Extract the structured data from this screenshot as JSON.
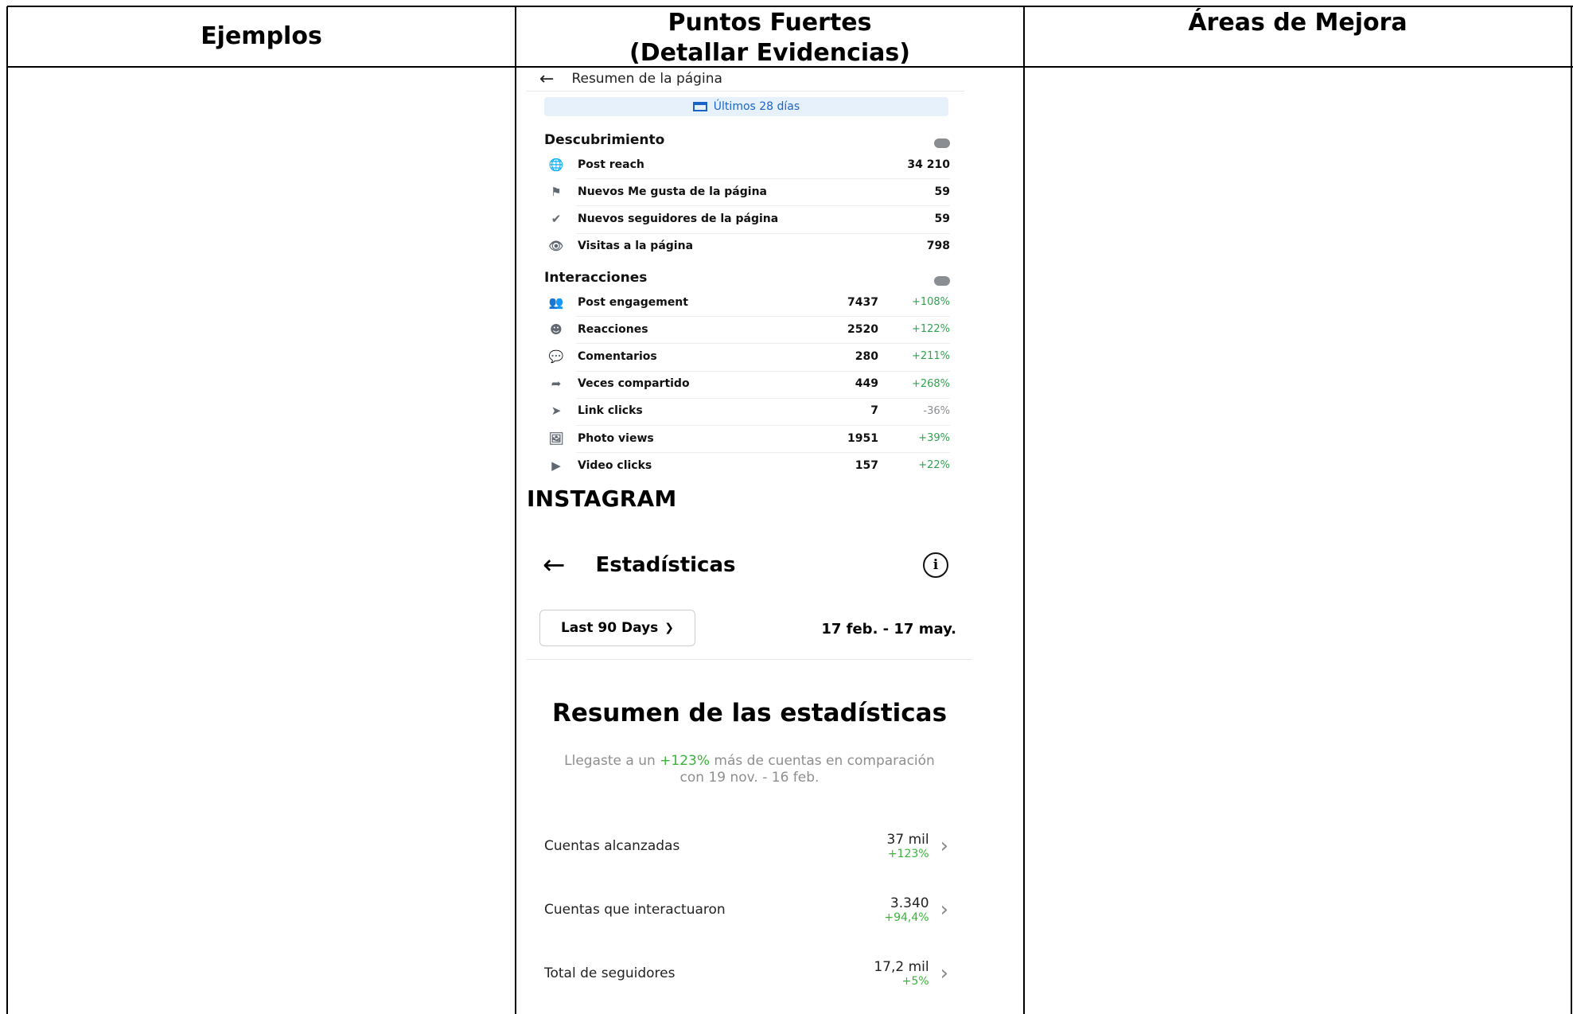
{
  "table": {
    "headers": {
      "col1": "Ejemplos",
      "col2_line1": "Puntos Fuertes",
      "col2_line2": "(Detallar Evidencias)",
      "col3": "Áreas de Mejora"
    }
  },
  "facebook": {
    "page_title": "Resumen de la página",
    "date_range": "Últimos 28 días",
    "discovery": {
      "title": "Descubrimiento",
      "rows": [
        {
          "icon": "globe-icon",
          "label": "Post reach",
          "value": "34 210"
        },
        {
          "icon": "flag-icon",
          "label": "Nuevos Me gusta de la página",
          "value": "59"
        },
        {
          "icon": "follow-icon",
          "label": "Nuevos seguidores de la página",
          "value": "59"
        },
        {
          "icon": "eye-icon",
          "label": "Visitas a la página",
          "value": "798"
        }
      ]
    },
    "interactions": {
      "title": "Interacciones",
      "rows": [
        {
          "icon": "people-icon",
          "label": "Post engagement",
          "value": "7437",
          "change": "+108%"
        },
        {
          "icon": "reaction-icon",
          "label": "Reacciones",
          "value": "2520",
          "change": "+122%"
        },
        {
          "icon": "comment-icon",
          "label": "Comentarios",
          "value": "280",
          "change": "+211%"
        },
        {
          "icon": "share-icon",
          "label": "Veces compartido",
          "value": "449",
          "change": "+268%"
        },
        {
          "icon": "cursor-icon",
          "label": "Link clicks",
          "value": "7",
          "change": "-36%"
        },
        {
          "icon": "photo-icon",
          "label": "Photo views",
          "value": "1951",
          "change": "+39%"
        },
        {
          "icon": "video-icon",
          "label": "Video clicks",
          "value": "157",
          "change": "+22%"
        }
      ]
    }
  },
  "instagram": {
    "section_label": "INSTAGRAM",
    "title": "Estadísticas",
    "filter_label": "Last 90 Days",
    "range": "17 feb. - 17 may.",
    "summary_title": "Resumen de las estadísticas",
    "summary_pre": "Llegaste a un ",
    "summary_pct": "+123%",
    "summary_post": " más de cuentas en comparación",
    "summary_line2": "con 19 nov. - 16 feb.",
    "rows": [
      {
        "label": "Cuentas alcanzadas",
        "value": "37 mil",
        "change": "+123%"
      },
      {
        "label": "Cuentas que interactuaron",
        "value": "3.340",
        "change": "+94,4%"
      },
      {
        "label": "Total de seguidores",
        "value": "17,2 mil",
        "change": "+5%"
      }
    ]
  }
}
